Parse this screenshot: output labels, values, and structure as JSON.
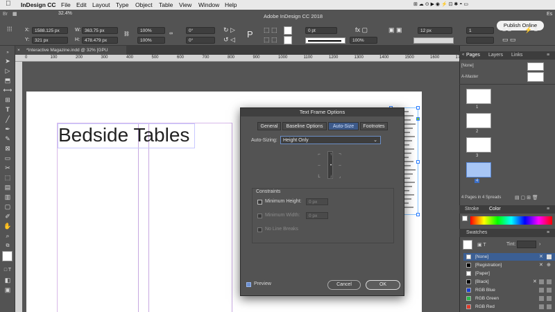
{
  "menubar": {
    "app": "InDesign CC",
    "items": [
      "File",
      "Edit",
      "Layout",
      "Type",
      "Object",
      "Table",
      "View",
      "Window",
      "Help"
    ]
  },
  "toolbar": {
    "zoom": "32.4%",
    "x": "1588.125 px",
    "y": "321 px",
    "w": "363.75 px",
    "h": "478.479 px",
    "scale_x": "100%",
    "scale_y": "100%",
    "rotate": "0°",
    "shear": "0°",
    "stroke": "0 pt",
    "opacity": "100%",
    "gutter": "12 px",
    "columns": "1",
    "app_title": "Adobe InDesign CC 2018",
    "publish_label": "Publish Online",
    "es_label": "Es"
  },
  "doc_tab": "*Interactive Magazine.indd @ 32% [GPU Preview]",
  "ruler_labels": [
    "0",
    "100",
    "200",
    "300",
    "400",
    "500",
    "600",
    "700",
    "800",
    "900",
    "1000",
    "1100",
    "1200",
    "1300",
    "1400",
    "1500",
    "1600",
    "1700"
  ],
  "page": {
    "headline": "Bedside Tables"
  },
  "dialog": {
    "title": "Text Frame Options",
    "tabs": [
      "General",
      "Baseline Options",
      "Auto-Size",
      "Footnotes"
    ],
    "active_tab": "Auto-Size",
    "autosizing_label": "Auto-Sizing:",
    "autosizing_value": "Height Only",
    "constraints_label": "Constraints",
    "min_height_label": "Minimum Height:",
    "min_height_value": "0 px",
    "min_width_label": "Minimum Width:",
    "min_width_value": "0 px",
    "no_line_breaks_label": "No Line Breaks",
    "preview_label": "Preview",
    "cancel_label": "Cancel",
    "ok_label": "OK"
  },
  "pages_panel": {
    "tabs": [
      "Pages",
      "Layers",
      "Links"
    ],
    "none_label": "[None]",
    "master_label": "A-Master",
    "page_numbers": [
      "1",
      "2",
      "3",
      "4"
    ],
    "summary": "4 Pages in 4 Spreads"
  },
  "stroke_panel": {
    "tabs": [
      "Stroke",
      "Color"
    ]
  },
  "swatches": {
    "title": "Swatches",
    "tint_label": "Tint:",
    "items": [
      {
        "name": "[None]",
        "color": "#ffffff"
      },
      {
        "name": "[Registration]",
        "color": "#000000"
      },
      {
        "name": "[Paper]",
        "color": "#ffffff"
      },
      {
        "name": "[Black]",
        "color": "#000000"
      },
      {
        "name": "RGB Blue",
        "color": "#1a3fd0"
      },
      {
        "name": "RGB Green",
        "color": "#2db84a"
      },
      {
        "name": "RGB Red",
        "color": "#e03a2a"
      }
    ]
  }
}
